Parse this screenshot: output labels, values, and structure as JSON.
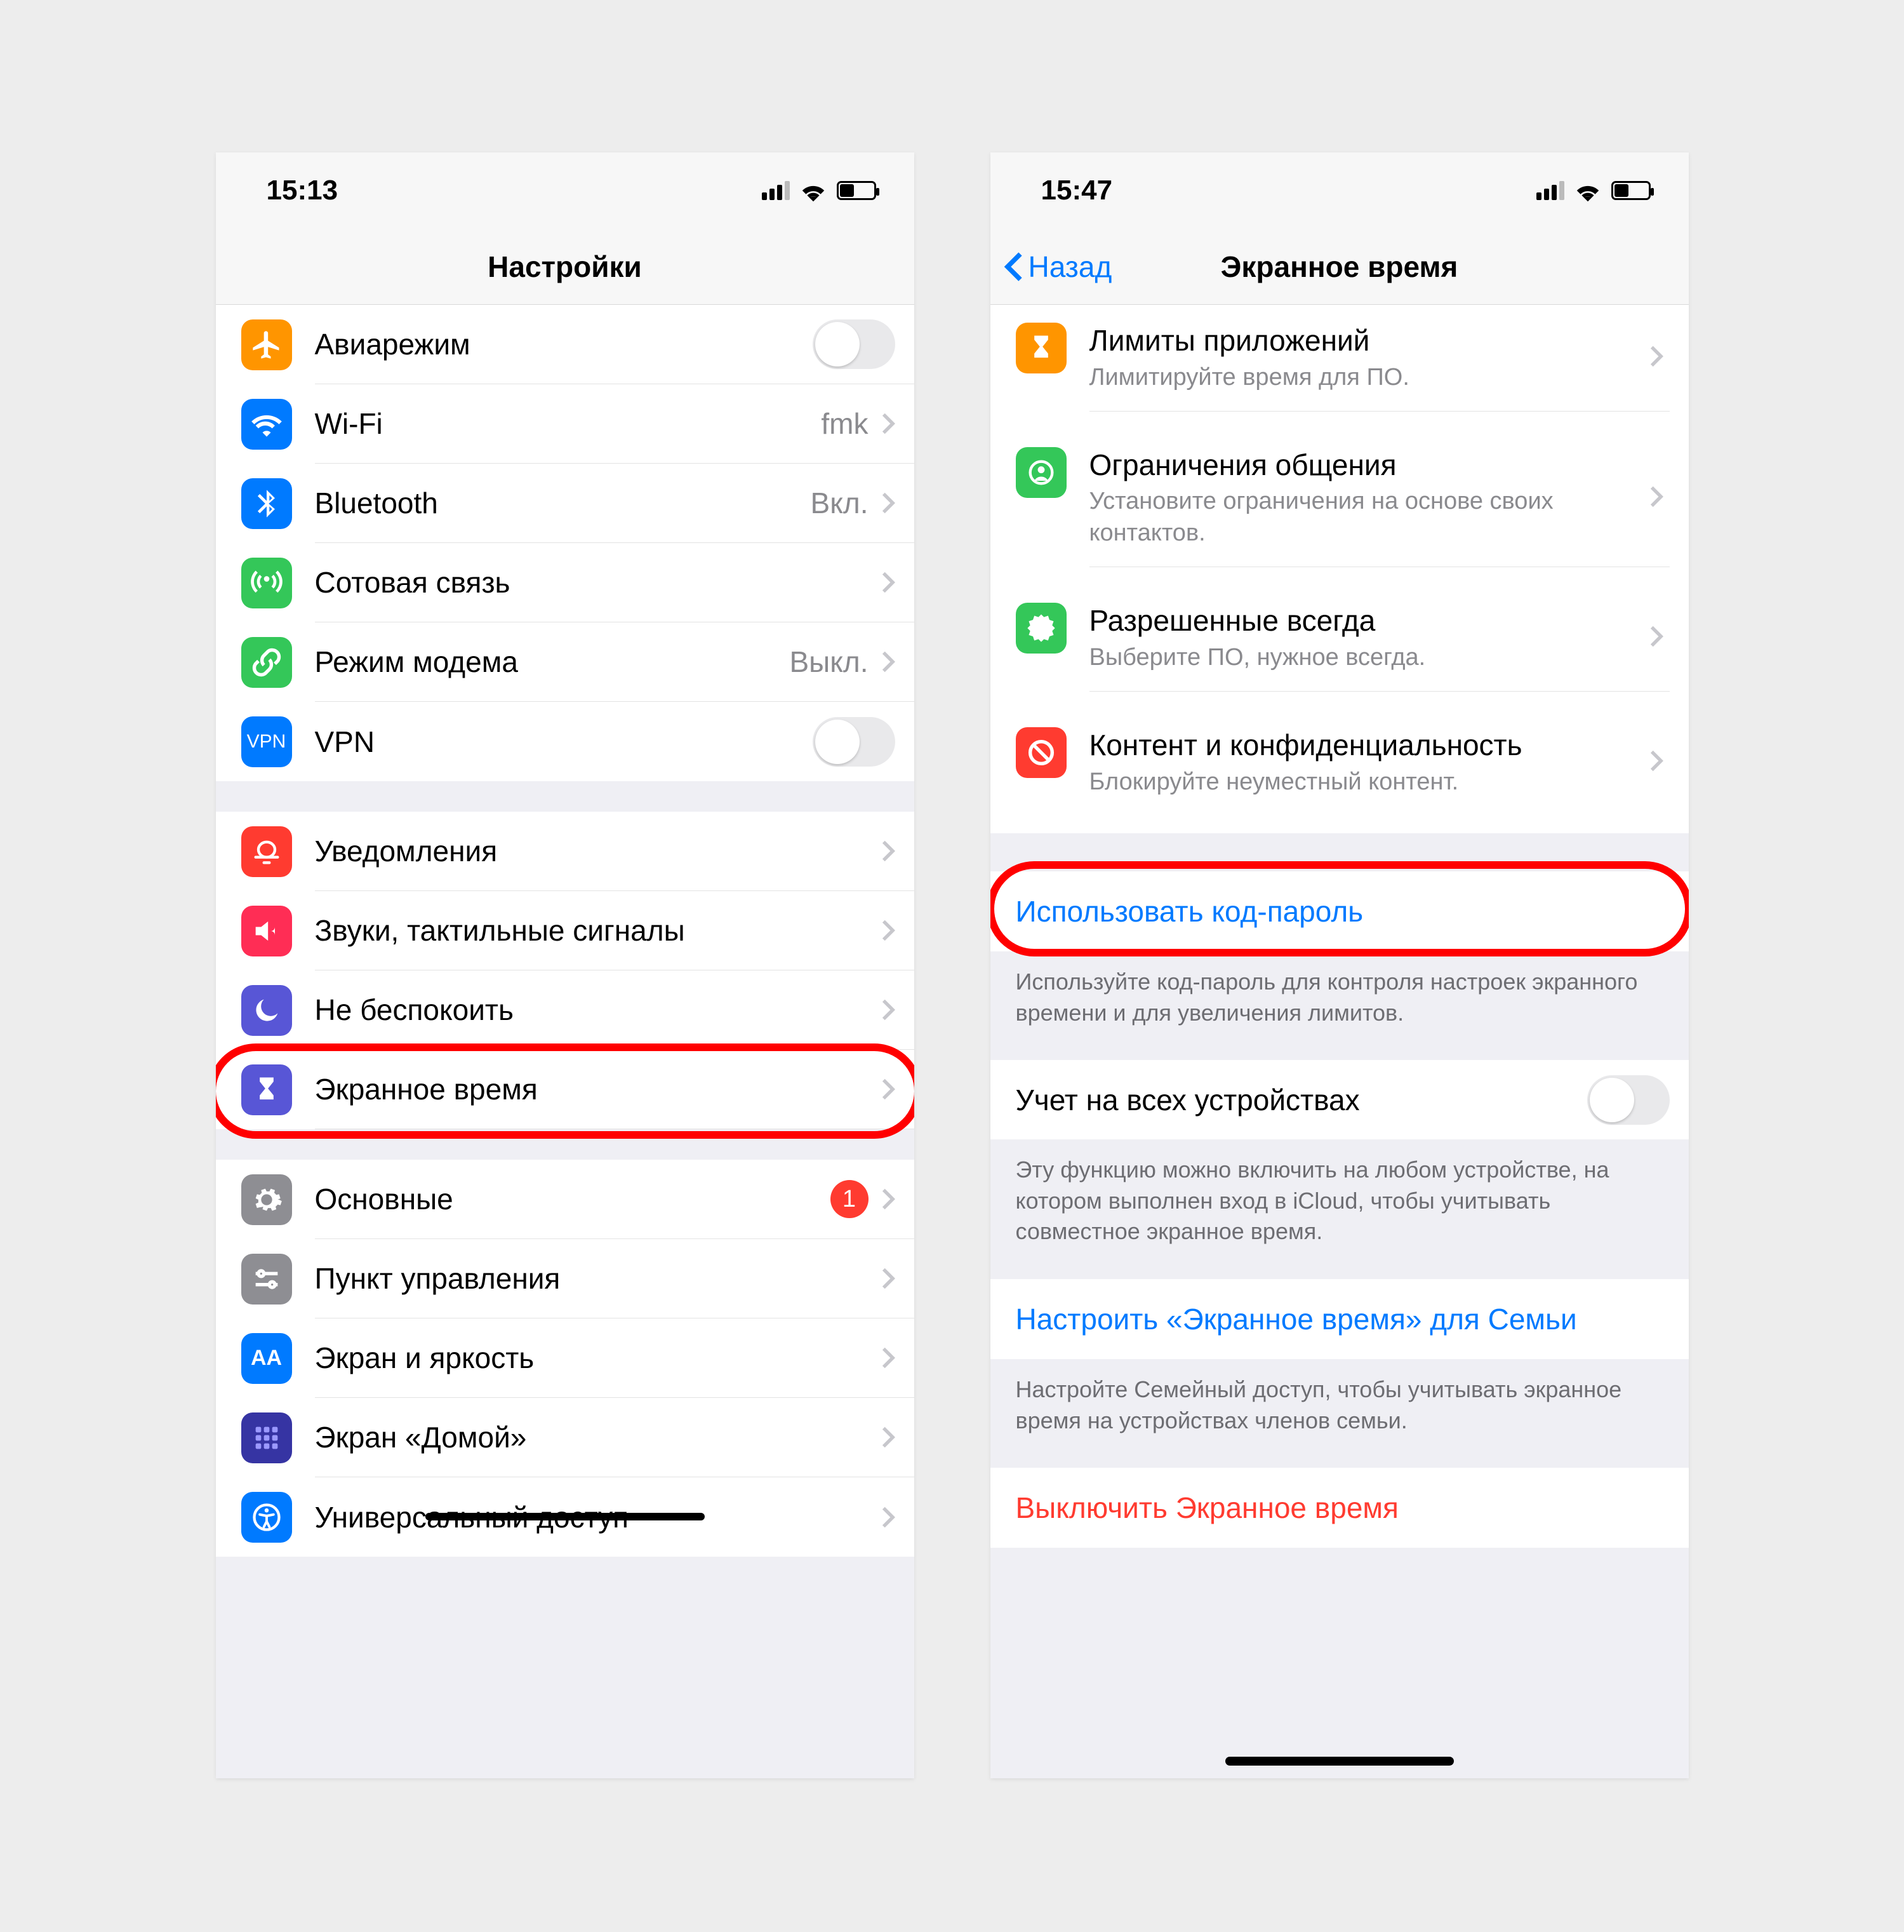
{
  "left": {
    "status_time": "15:13",
    "title": "Настройки",
    "g1": [
      {
        "icon": "airplane",
        "bg": "#ff9500",
        "label": "Авиарежим",
        "toggle": true
      },
      {
        "icon": "wifi",
        "bg": "#007aff",
        "label": "Wi-Fi",
        "detail": "fmk",
        "chev": true
      },
      {
        "icon": "bluetooth",
        "bg": "#007aff",
        "label": "Bluetooth",
        "detail": "Вкл.",
        "chev": true
      },
      {
        "icon": "cell",
        "bg": "#34c759",
        "label": "Сотовая связь",
        "chev": true
      },
      {
        "icon": "hotspot",
        "bg": "#34c759",
        "label": "Режим модема",
        "detail": "Выкл.",
        "chev": true
      },
      {
        "icon": "vpn",
        "bg": "#007aff",
        "label": "VPN",
        "toggle": true
      }
    ],
    "g2": [
      {
        "icon": "bell",
        "bg": "#ff3b30",
        "label": "Уведомления",
        "chev": true
      },
      {
        "icon": "sound",
        "bg": "#ff2d55",
        "label": "Звуки, тактильные сигналы",
        "chev": true
      },
      {
        "icon": "moon",
        "bg": "#5856d6",
        "label": "Не беспокоить",
        "chev": true
      },
      {
        "icon": "hourglass",
        "bg": "#5856d6",
        "label": "Экранное время",
        "chev": true
      }
    ],
    "g3": [
      {
        "icon": "gear",
        "bg": "#8e8e93",
        "label": "Основные",
        "badge": "1",
        "chev": true
      },
      {
        "icon": "control",
        "bg": "#8e8e93",
        "label": "Пункт управления",
        "chev": true
      },
      {
        "icon": "aa",
        "bg": "#007aff",
        "label": "Экран и яркость",
        "chev": true
      },
      {
        "icon": "grid",
        "bg": "#3634a3",
        "label": "Экран «Домой»",
        "chev": true
      },
      {
        "icon": "access",
        "bg": "#007aff",
        "label": "Универсальный доступ",
        "chev": true
      }
    ]
  },
  "right": {
    "status_time": "15:47",
    "back": "Назад",
    "title": "Экранное время",
    "items": [
      {
        "icon": "hourglass",
        "bg": "#ff9500",
        "t1": "Лимиты приложений",
        "t2": "Лимитируйте время для ПО."
      },
      {
        "icon": "person",
        "bg": "#34c759",
        "t1": "Ограничения общения",
        "t2": "Установите ограничения на основе своих контактов."
      },
      {
        "icon": "check",
        "bg": "#34c759",
        "t1": "Разрешенные всегда",
        "t2": "Выберите ПО, нужное всегда."
      },
      {
        "icon": "no",
        "bg": "#ff3b30",
        "t1": "Контент и конфиденциальность",
        "t2": "Блокируйте неуместный контент."
      }
    ],
    "use_passcode": "Использовать код-пароль",
    "use_passcode_footer": "Используйте код-пароль для контроля настроек экранного времени и для увеличения лимитов.",
    "share_label": "Учет на всех устройствах",
    "share_footer": "Эту функцию можно включить на любом устройстве, на котором выполнен вход в iCloud, чтобы учитывать совместное экранное время.",
    "family_label": "Настроить «Экранное время» для Семьи",
    "family_footer": "Настройте Семейный доступ, чтобы учитывать экранное время на устройствах членов семьи.",
    "turn_off": "Выключить Экранное время"
  }
}
